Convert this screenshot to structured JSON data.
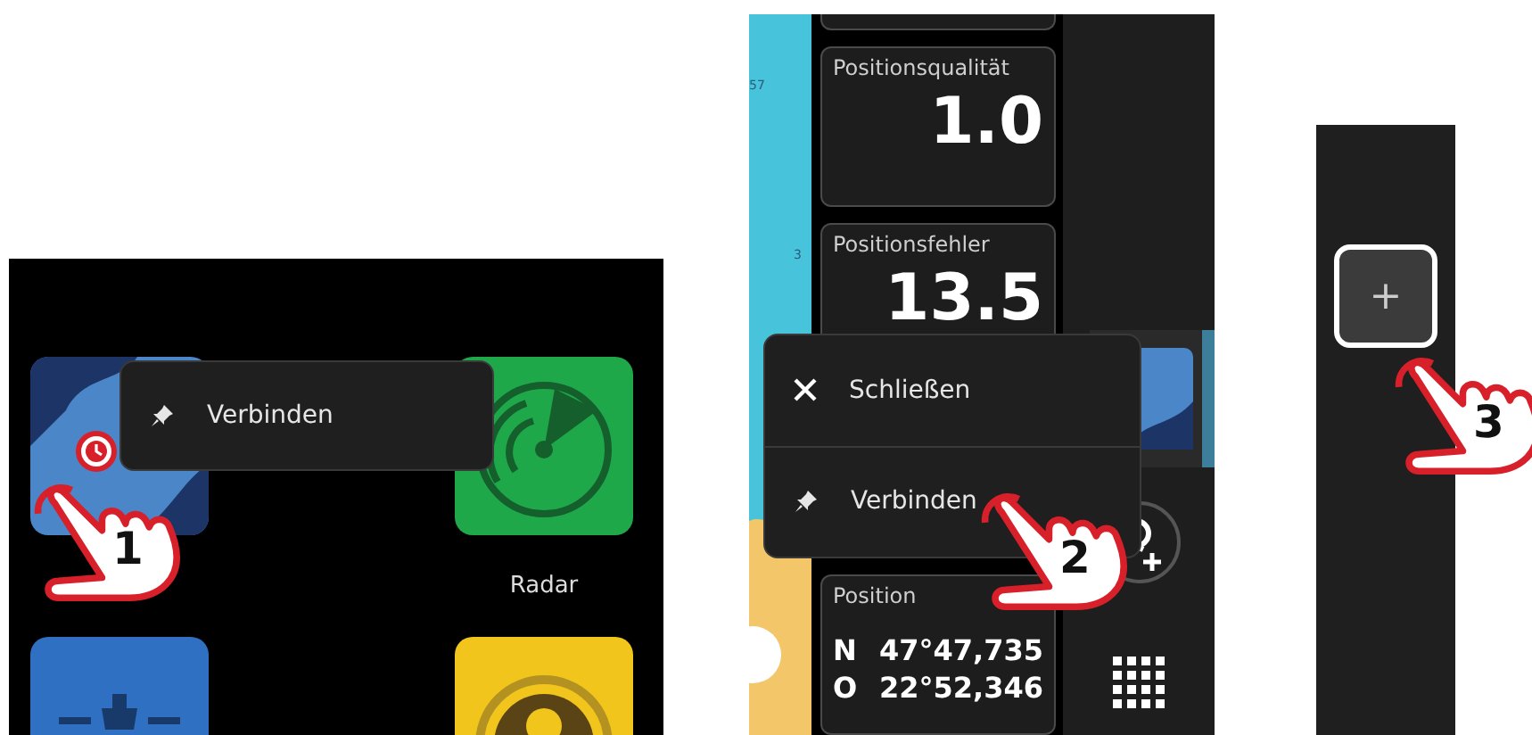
{
  "panel_1": {
    "tiles": [
      {
        "kind": "chart"
      },
      {
        "kind": "radar",
        "label": "Radar"
      },
      {
        "kind": "ship"
      },
      {
        "kind": "sonar"
      }
    ],
    "menu": {
      "items": [
        {
          "kind": "pin",
          "label": "Verbinden"
        }
      ]
    },
    "step": "1"
  },
  "panel_2": {
    "map_labels": [
      "57",
      "3"
    ],
    "data_cards": [
      {
        "title": "Positionsqualität",
        "value": "1.0"
      },
      {
        "title": "Positionsfehler",
        "value": "13.5"
      },
      {
        "title": "Position",
        "rows": [
          {
            "axis": "N",
            "value": "47°47,735"
          },
          {
            "axis": "O",
            "value": "22°52,346"
          }
        ]
      }
    ],
    "menu": {
      "items": [
        {
          "kind": "close",
          "label": "Schließen"
        },
        {
          "kind": "pin",
          "label": "Verbinden"
        }
      ]
    },
    "step": "2"
  },
  "panel_3": {
    "add_button": {
      "label": "+"
    },
    "step": "3"
  }
}
